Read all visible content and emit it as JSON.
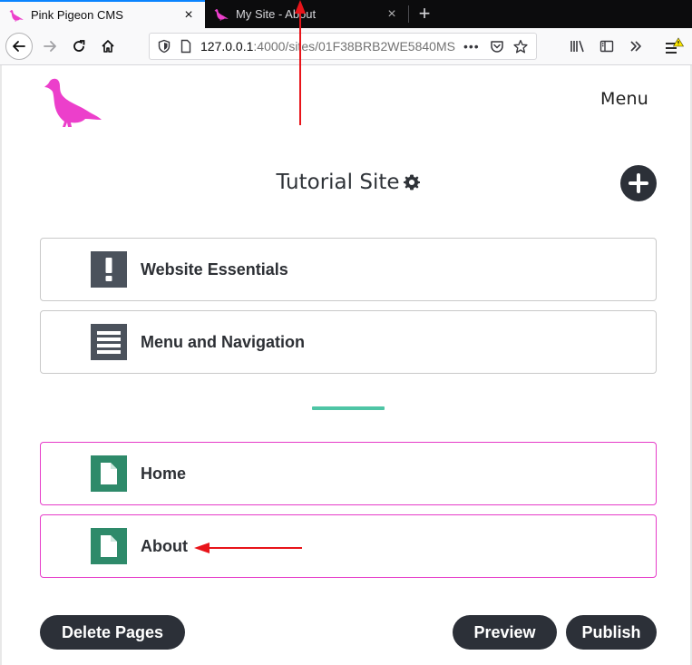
{
  "browser": {
    "tabs": [
      {
        "title": "Pink Pigeon CMS",
        "active": true
      },
      {
        "title": "My Site - About",
        "active": false
      }
    ],
    "url": {
      "host": "127.0.0.1",
      "rest": ":4000/sites/01F38BRB2WE5840MS"
    }
  },
  "header": {
    "menu_label": "Menu"
  },
  "site": {
    "title": "Tutorial Site"
  },
  "sections": [
    {
      "label": "Website Essentials",
      "icon": "exclamation-icon"
    },
    {
      "label": "Menu and Navigation",
      "icon": "menu-lines-icon"
    }
  ],
  "pages": [
    {
      "label": "Home",
      "icon": "page-icon"
    },
    {
      "label": "About",
      "icon": "page-icon"
    }
  ],
  "actions": {
    "delete": "Delete Pages",
    "preview": "Preview",
    "publish": "Publish"
  },
  "colors": {
    "brand_pink": "#ec3fcb",
    "accent_teal": "#4ec5a5",
    "icon_green": "#2e8a6a",
    "icon_gray": "#4b525c",
    "button_dark": "#2c3038",
    "annotation_red": "#e8141a"
  }
}
